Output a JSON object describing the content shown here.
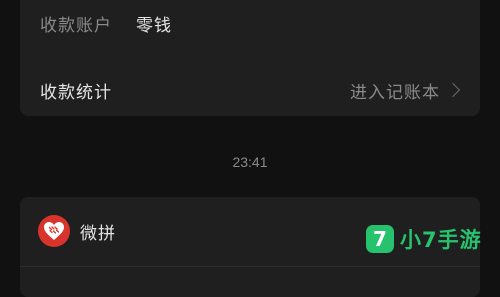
{
  "receipt": {
    "account_label": "收款账户",
    "account_value": "零钱",
    "stats_label": "收款统计",
    "stats_link": "进入记账本"
  },
  "timestamp": "23:41",
  "message": {
    "sender": "微拼",
    "avatar_icon": "pinduoduo-heart-logo-icon",
    "avatar_color": "#d9342b"
  },
  "watermark": {
    "badge": "7",
    "text": "小7手游",
    "color": "#27c26d"
  },
  "colors": {
    "background": "#111111",
    "card": "#1f1f1f",
    "primary_text": "#e6e6e6",
    "secondary_text": "#8a8a8a"
  }
}
